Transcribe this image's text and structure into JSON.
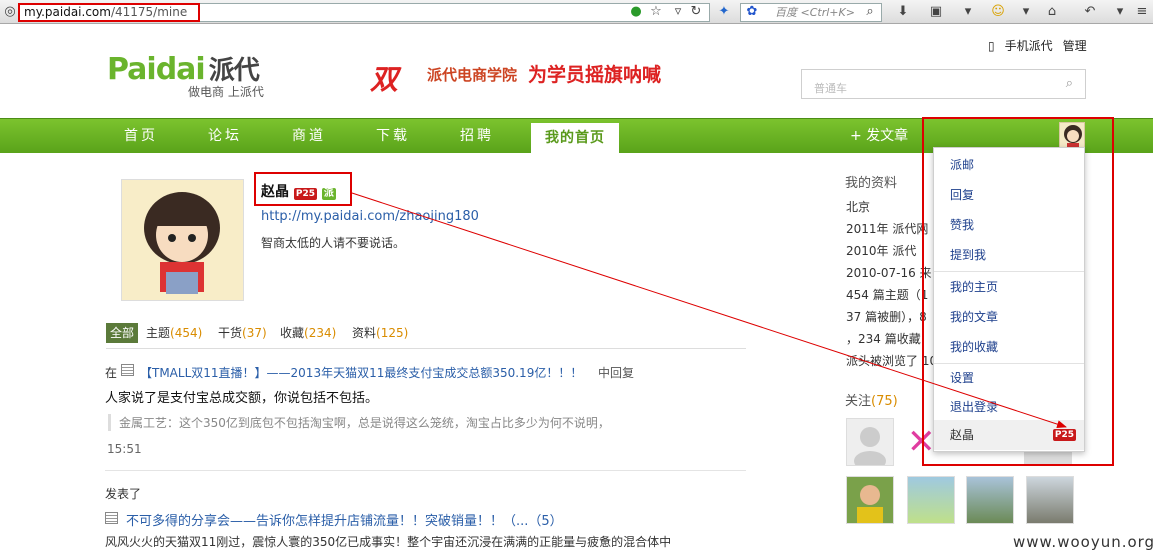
{
  "browser": {
    "url_domain": "my.paidai.com",
    "url_path": "/41175/mine",
    "search_placeholder": "百度 <Ctrl+K>"
  },
  "header": {
    "logo_en": "Paidai",
    "logo_cn": "派代",
    "slogan": "做电商 上派代",
    "banner_mark": "双",
    "banner_org": "派代电商学院",
    "banner_text": "为学员摇旗呐喊",
    "top_links": [
      "手机派代",
      "管理"
    ],
    "search_placeholder": "普通车"
  },
  "nav": {
    "items": [
      "首页",
      "论坛",
      "商道",
      "下载",
      "招聘"
    ],
    "active": "我的首页",
    "post_button": "+ 发文章"
  },
  "profile": {
    "name": "赵晶",
    "badge": "P25",
    "badge2": "派",
    "url": "http://my.paidai.com/zhaojing180",
    "bio": "智商太低的人请不要说话。"
  },
  "tabs": [
    {
      "label": "全部",
      "count": ""
    },
    {
      "label": "主题",
      "count": "(454)"
    },
    {
      "label": "干货",
      "count": "(37)"
    },
    {
      "label": "收藏",
      "count": "(234)"
    },
    {
      "label": "资料",
      "count": "(125)"
    }
  ],
  "feed": {
    "item1_prefix": "在",
    "item1_link": "【TMALL双11直播！】——2013年天猫双11最终支付宝成交总额350.19亿！！！",
    "item1_action": "中回复",
    "item1_text": "人家说了是支付宝总成交额，你说包括不包括。",
    "item1_quote": "金属工艺：这个350亿到底包不包括淘宝啊，总是说得这么笼统，淘宝占比多少为何不说明，",
    "item1_time": "15:51",
    "item2_prefix": "发表了",
    "item2_link": "不可多得的分享会——告诉你怎样提升店铺流量！！突破销量！！（...（5）",
    "item2_text": "风风火火的天猫双11刚过，震惊人寰的350亿已成事实！整个宇宙还沉浸在满满的正能量与疲惫的混合体中"
  },
  "sidebar": {
    "title": "我的资料",
    "lines": [
      "北京",
      "2011年 派代网",
      "2010年 派代",
      "2010-07-16 来",
      "454 篇主题（1",
      "37 篇被删），8",
      "，234 篇收藏",
      "派头被浏览了 10"
    ],
    "follow_label": "关注",
    "follow_count": "(75)"
  },
  "dropdown": {
    "items": [
      "派邮",
      "回复",
      "赞我",
      "提到我",
      "我的主页",
      "我的文章",
      "我的收藏",
      "设置",
      "退出登录"
    ],
    "user_name": "赵晶",
    "user_badge": "P25"
  },
  "watermark": "www.wooyun.org",
  "colors": {
    "brand_green": "#6ab42d",
    "annotation_red": "#dd0000",
    "link_blue": "#2a5ea8"
  }
}
